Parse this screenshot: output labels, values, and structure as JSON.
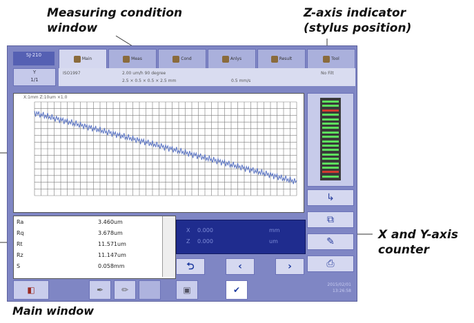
{
  "callouts": {
    "measuring_condition": [
      "Measuring condition",
      "window"
    ],
    "z_axis": [
      "Z-axis indicator",
      "(stylus position)"
    ],
    "xy_counter": [
      "X and Y-axis",
      "counter"
    ],
    "main_window": "Main window"
  },
  "app": {
    "badge": "SJ-210"
  },
  "tabs": [
    {
      "icon": "home-icon",
      "label": "Main"
    },
    {
      "icon": "measure-icon",
      "label": "Meas"
    },
    {
      "icon": "condition-icon",
      "label": "Cond"
    },
    {
      "icon": "analysis-icon",
      "label": "Anlys"
    },
    {
      "icon": "result-icon",
      "label": "Result"
    },
    {
      "icon": "tool-icon",
      "label": "Tool"
    }
  ],
  "condition": {
    "standard": "ISO1997",
    "cutoff": "2.00 um/h  90 degree",
    "lengths": "2.5 × 0.5 × 0.5 × 2.5 mm",
    "speed": "0.5 mm/s",
    "filter": "No Filt",
    "y_button": [
      "Y",
      "1/1"
    ]
  },
  "graph": {
    "scale_label": "X:1mm  Z:10um  ×1.0"
  },
  "params": [
    {
      "name": "Ra",
      "value": "3.460um"
    },
    {
      "name": "Rq",
      "value": "3.678um"
    },
    {
      "name": "Rt",
      "value": "11.571um"
    },
    {
      "name": "Rz",
      "value": "11.147um"
    },
    {
      "name": "S",
      "value": "0.058mm"
    }
  ],
  "counter": {
    "x_label": "X",
    "x_value": "0.000",
    "x_unit": "mm",
    "z_label": "Z",
    "z_value": "0.000",
    "z_unit": "um"
  },
  "nav": {
    "back": "⮌",
    "prev": "‹",
    "next": "›"
  },
  "datetime": [
    "2015/02/01",
    "13:26:58"
  ],
  "colors": {
    "screen_bg": "#7f86c4",
    "counter_bg": "#1f2c8e",
    "zbar_green": "#5de05d",
    "zbar_red": "#d33a2f"
  }
}
